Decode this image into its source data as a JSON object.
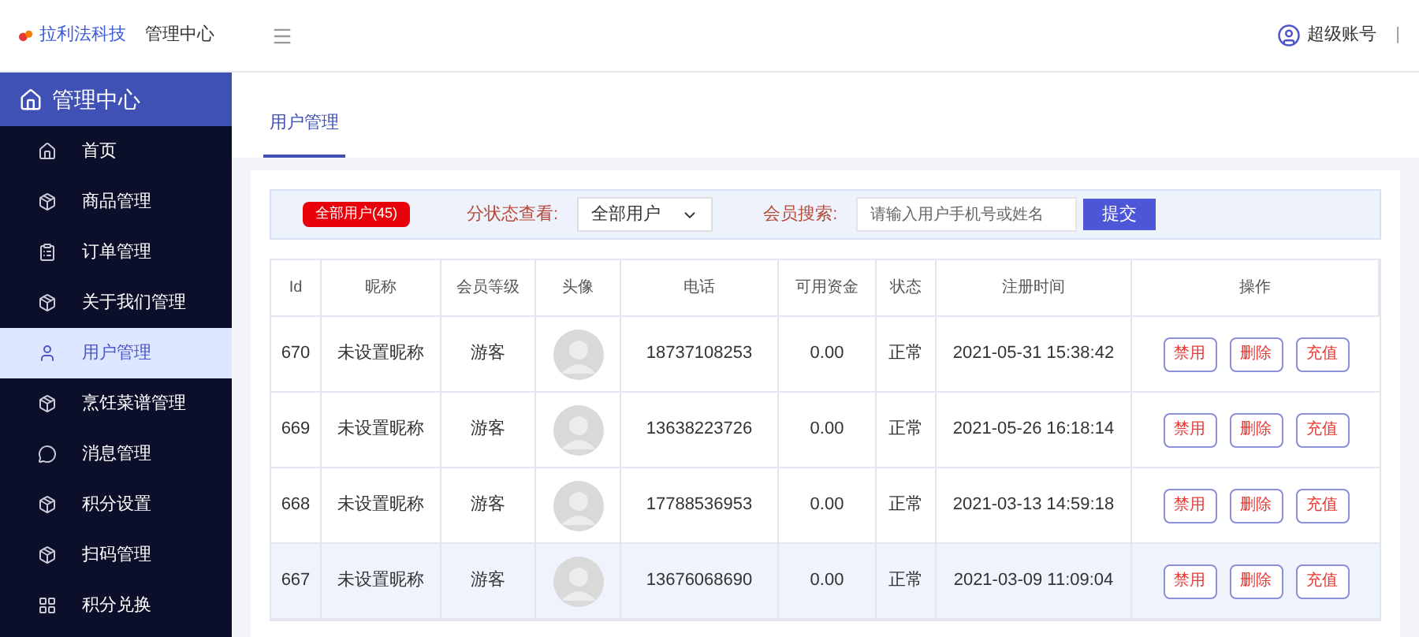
{
  "header": {
    "brand": "拉利法科技",
    "title": "管理中心",
    "account": "超级账号",
    "separator": "|"
  },
  "sidebar": {
    "title": "管理中心",
    "items": [
      {
        "label": "首页",
        "kind": "home",
        "selected": false
      },
      {
        "label": "商品管理",
        "kind": "box",
        "selected": false
      },
      {
        "label": "订单管理",
        "kind": "clipboard",
        "selected": false
      },
      {
        "label": "关于我们管理",
        "kind": "box",
        "selected": false
      },
      {
        "label": "用户管理",
        "kind": "user",
        "selected": true
      },
      {
        "label": "烹饪菜谱管理",
        "kind": "box",
        "selected": false
      },
      {
        "label": "消息管理",
        "kind": "chat",
        "selected": false
      },
      {
        "label": "积分设置",
        "kind": "box",
        "selected": false
      },
      {
        "label": "扫码管理",
        "kind": "box",
        "selected": false
      },
      {
        "label": "积分兑换",
        "kind": "grid",
        "selected": false
      }
    ]
  },
  "tabs": [
    {
      "label": "用户管理",
      "selected": true
    }
  ],
  "filter": {
    "badge": "全部用户(45)",
    "status_label": "分状态查看:",
    "status_value": "全部用户",
    "search_label": "会员搜索:",
    "search_placeholder": "请输入用户手机号或姓名",
    "submit": "提交"
  },
  "table": {
    "columns": [
      "Id",
      "昵称",
      "会员等级",
      "头像",
      "电话",
      "可用资金",
      "状态",
      "注册时间",
      "操作"
    ],
    "rows": [
      {
        "id": "670",
        "nickname": "未设置昵称",
        "level": "游客",
        "phone": "18737108253",
        "funds": "0.00",
        "status": "正常",
        "registered": "2021-05-31 15:38:42",
        "actions": [
          "禁用",
          "删除",
          "充值"
        ],
        "selected": false
      },
      {
        "id": "669",
        "nickname": "未设置昵称",
        "level": "游客",
        "phone": "13638223726",
        "funds": "0.00",
        "status": "正常",
        "registered": "2021-05-26 16:18:14",
        "actions": [
          "禁用",
          "删除",
          "充值"
        ],
        "selected": false
      },
      {
        "id": "668",
        "nickname": "未设置昵称",
        "level": "游客",
        "phone": "17788536953",
        "funds": "0.00",
        "status": "正常",
        "registered": "2021-03-13 14:59:18",
        "actions": [
          "禁用",
          "删除",
          "充值"
        ],
        "selected": false
      },
      {
        "id": "667",
        "nickname": "未设置昵称",
        "level": "游客",
        "phone": "13676068690",
        "funds": "0.00",
        "status": "正常",
        "registered": "2021-03-09 11:09:04",
        "actions": [
          "禁用",
          "删除",
          "充值"
        ],
        "selected": true
      }
    ]
  }
}
